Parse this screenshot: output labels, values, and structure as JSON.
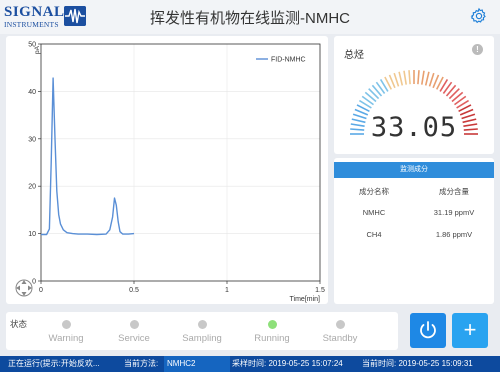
{
  "logo": {
    "line1": "SIGNAL",
    "line2": "INSTRUMENTS"
  },
  "app_title": "挥发性有机物在线监测-NMHC",
  "chart": {
    "y_unit_label": "pA",
    "y_ticks": [
      "50",
      "40",
      "30",
      "20",
      "10",
      "0"
    ],
    "x_ticks": [
      "0",
      "0.5",
      "1",
      "1.5"
    ],
    "x_label": "Time[min]",
    "legend": "FID-NMHC"
  },
  "chart_data": {
    "type": "line",
    "xlabel": "Time[min]",
    "ylabel": "pA",
    "xlim": [
      0,
      1.5
    ],
    "ylim": [
      0,
      50
    ],
    "series": [
      {
        "name": "FID-NMHC",
        "color": "#5a8fd6",
        "x": [
          0.0,
          0.03,
          0.045,
          0.055,
          0.065,
          0.075,
          0.085,
          0.095,
          0.105,
          0.12,
          0.14,
          0.17,
          0.2,
          0.25,
          0.3,
          0.35,
          0.37,
          0.385,
          0.395,
          0.405,
          0.415,
          0.425,
          0.44,
          0.47,
          0.5
        ],
        "y": [
          9.8,
          9.8,
          11,
          25,
          42.8,
          30,
          19,
          14,
          12,
          10.8,
          10.2,
          10,
          9.9,
          9.9,
          9.8,
          9.9,
          10.8,
          13.5,
          17.5,
          16,
          12.5,
          10.4,
          9.9,
          9.9,
          10
        ]
      }
    ],
    "legend_position": "top-right"
  },
  "gauge": {
    "title": "总烃",
    "info_symbol": "!",
    "value": "33.05",
    "min": 0,
    "max": 100,
    "colors": [
      "#5aa9e6",
      "#7fc3e8",
      "#f0c890",
      "#e8a070",
      "#e06060",
      "#c83a3a"
    ]
  },
  "components": {
    "header": "监测成分",
    "columns": [
      "成分名称",
      "成分含量"
    ],
    "rows": [
      [
        "NMHC",
        "31.19 ppmV"
      ],
      [
        "CH4",
        "1.86 ppmV"
      ]
    ]
  },
  "status": {
    "label": "状态",
    "items": [
      "Warning",
      "Service",
      "Sampling",
      "Running",
      "Standby"
    ],
    "active": "Running",
    "active_color": "#8ee07a"
  },
  "footer": {
    "state": "正在运行(提示:开始反欢...",
    "method_label": "当前方法:",
    "method_value": "NMHC2",
    "sample_time": "采样时间: 2019-05-25 15:07:24",
    "current_time": "当前时间: 2019-05-25 15:09:31"
  }
}
